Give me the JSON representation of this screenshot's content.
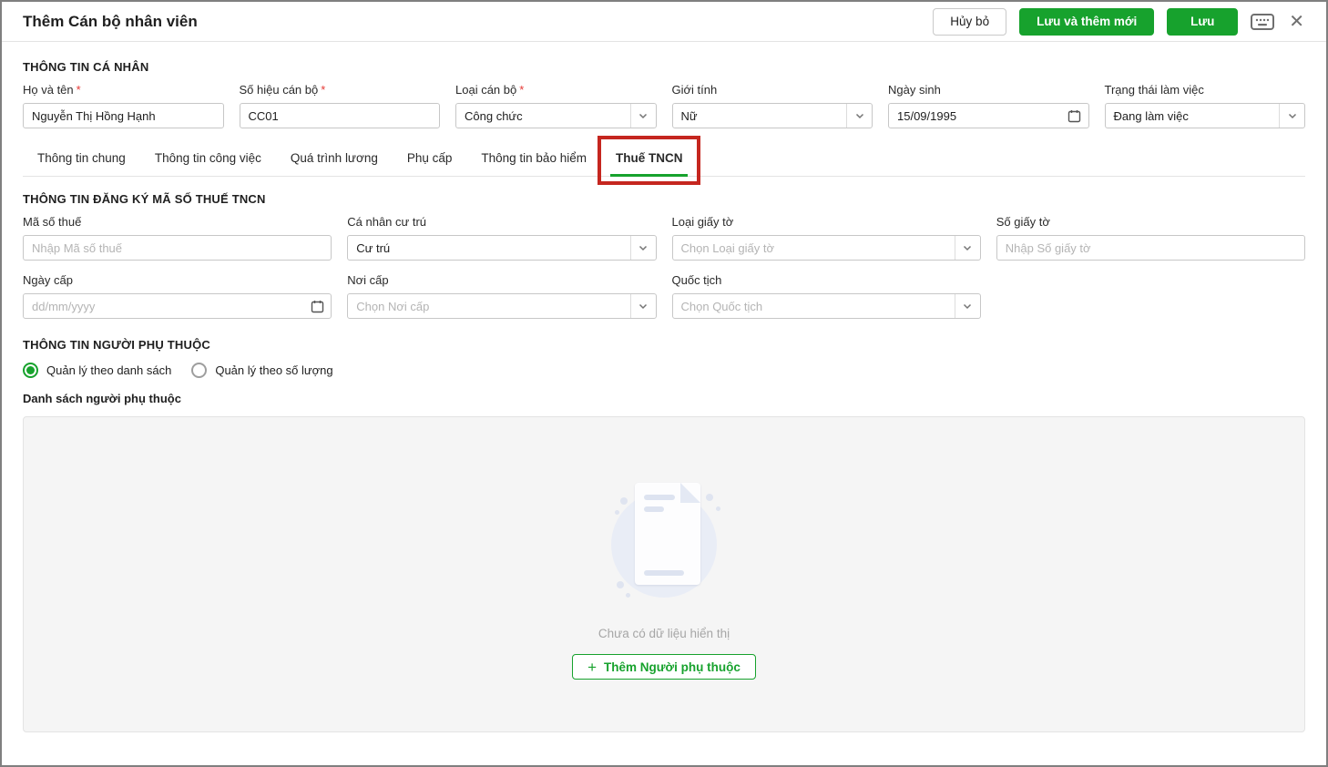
{
  "window": {
    "title": "Thêm Cán bộ nhân viên"
  },
  "header": {
    "cancel_label": "Hủy bỏ",
    "save_and_new_label": "Lưu và thêm mới",
    "save_label": "Lưu",
    "close_glyph": "✕"
  },
  "colors": {
    "primary_green": "#17a22d",
    "annotation_red": "#c5261f"
  },
  "personal": {
    "heading": "THÔNG TIN CÁ NHÂN",
    "fields": [
      {
        "label": "Họ và tên",
        "required": "*",
        "value": "Nguyễn Thị Hồng Hạnh",
        "type": "text"
      },
      {
        "label": "Số hiệu cán bộ",
        "required": "*",
        "value": "CC01",
        "type": "text"
      },
      {
        "label": "Loại cán bộ",
        "required": "*",
        "value": "Công chức",
        "type": "select"
      },
      {
        "label": "Giới tính",
        "required": "",
        "value": "Nữ",
        "type": "select"
      },
      {
        "label": "Ngày sinh",
        "required": "",
        "value": "15/09/1995",
        "type": "date"
      },
      {
        "label": "Trạng thái làm việc",
        "required": "",
        "value": "Đang làm việc",
        "type": "select"
      }
    ]
  },
  "tabs": {
    "items": [
      {
        "label": "Thông tin chung"
      },
      {
        "label": "Thông tin công việc"
      },
      {
        "label": "Quá trình lương"
      },
      {
        "label": "Phụ cấp"
      },
      {
        "label": "Thông tin bảo hiểm"
      },
      {
        "label": "Thuế TNCN"
      }
    ],
    "active_label": "Thuế TNCN"
  },
  "tax": {
    "heading": "THÔNG TIN ĐĂNG KÝ MÃ SỐ THUẾ TNCN",
    "fields": [
      {
        "label": "Mã số thuế",
        "placeholder": "Nhập Mã số thuế",
        "type": "text"
      },
      {
        "label": "Cá nhân cư trú",
        "value": "Cư trú",
        "type": "select"
      },
      {
        "label": "Loại giấy tờ",
        "placeholder": "Chọn Loại giấy tờ",
        "type": "select"
      },
      {
        "label": "Số giấy tờ",
        "placeholder": "Nhập Số giấy tờ",
        "type": "text"
      },
      {
        "label": "Ngày cấp",
        "placeholder": "dd/mm/yyyy",
        "type": "date"
      },
      {
        "label": "Nơi cấp",
        "placeholder": "Chọn Nơi cấp",
        "type": "select"
      },
      {
        "label": "Quốc tịch",
        "placeholder": "Chọn Quốc tịch",
        "type": "select"
      }
    ]
  },
  "dependents": {
    "heading": "THÔNG TIN NGƯỜI PHỤ THUỘC",
    "radio_list": "Quản lý theo danh sách",
    "radio_count": "Quản lý theo số lượng",
    "selected_radio": "Quản lý theo danh sách",
    "list_label": "Danh sách người phụ thuộc",
    "empty_text": "Chưa có dữ liệu hiển thị",
    "add_button_label": "Thêm Người phụ thuộc",
    "plus_glyph": "+"
  }
}
